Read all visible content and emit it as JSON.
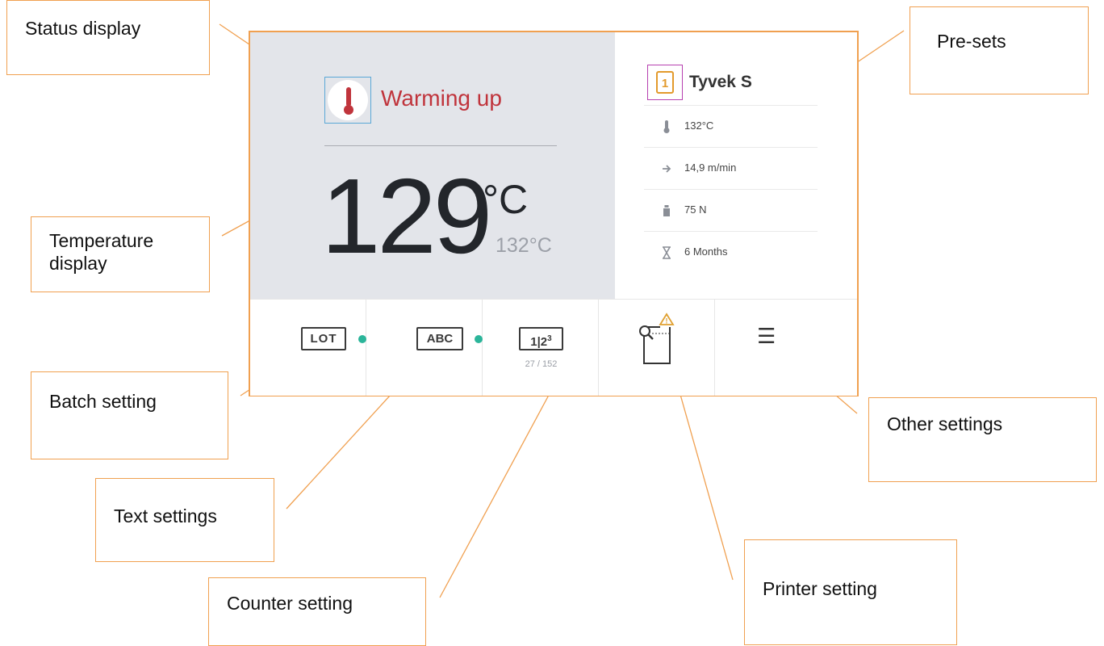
{
  "status": {
    "text": "Warming up",
    "icon": "thermometer-icon"
  },
  "temperature": {
    "current": "129",
    "unit": "°C",
    "setpoint": "132°C"
  },
  "preset": {
    "number": "1",
    "name": "Tyvek S",
    "rows": [
      {
        "icon": "thermometer-icon",
        "value": "132°C"
      },
      {
        "icon": "arrow-right-icon",
        "value": "14,9 m/min"
      },
      {
        "icon": "weight-icon",
        "value": "75 N"
      },
      {
        "icon": "hourglass-icon",
        "value": "6 Months"
      }
    ]
  },
  "bottom_bar": {
    "lot_label": "LOT",
    "text_label": "ABC",
    "counter_label": "1|2",
    "counter_sup": "3",
    "counter_value": "27 / 152",
    "printer_icon": "printer-search-icon",
    "printer_warning": "!",
    "menu_icon": "☰"
  },
  "callouts": {
    "status_display": "Status display",
    "presets": "Pre-sets",
    "temperature_display_line1": "Temperature",
    "temperature_display_line2": "display",
    "batch_setting": "Batch setting",
    "text_settings": "Text settings",
    "counter_setting": "Counter setting",
    "printer_setting": "Printer setting",
    "other_settings": "Other settings"
  },
  "colors": {
    "accent": "#f0a050",
    "status_red": "#c0343c",
    "dot_green": "#2bb59a",
    "panel_gray": "#e3e5ea"
  }
}
